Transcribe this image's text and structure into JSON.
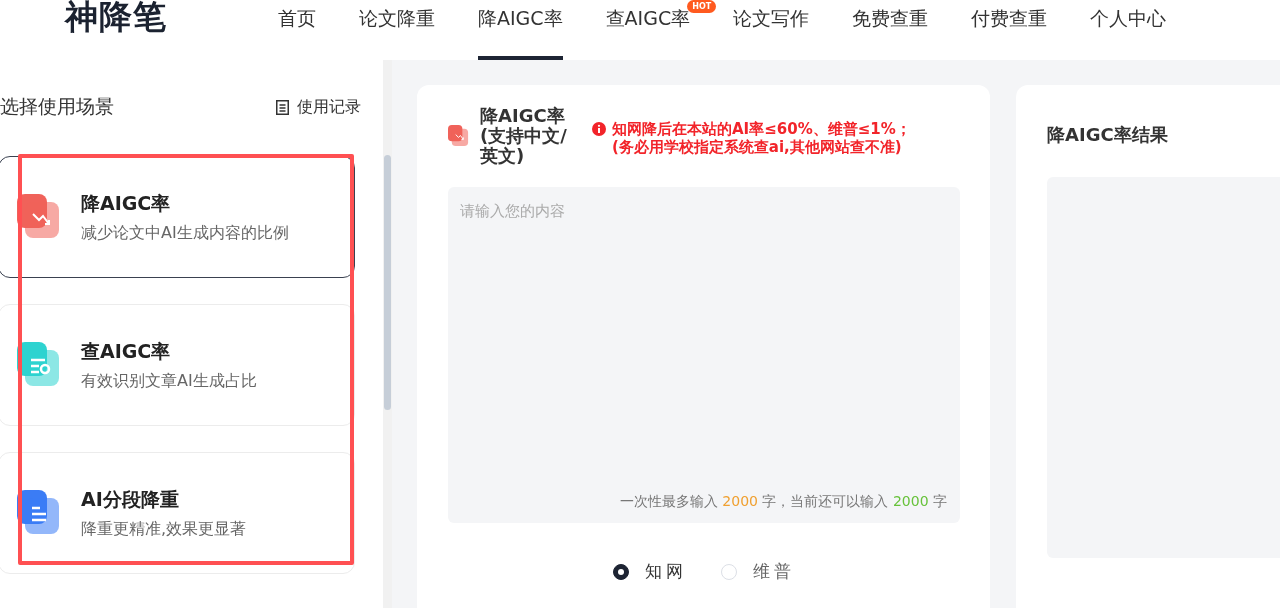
{
  "logo": "神降笔",
  "nav": [
    {
      "label": "首页",
      "selected": false
    },
    {
      "label": "论文降重",
      "selected": false
    },
    {
      "label": "降AIGC率",
      "selected": true
    },
    {
      "label": "查AIGC率",
      "selected": false,
      "badge": "HOT"
    },
    {
      "label": "论文写作",
      "selected": false
    },
    {
      "label": "免费查重",
      "selected": false
    },
    {
      "label": "付费查重",
      "selected": false
    },
    {
      "label": "个人中心",
      "selected": false
    }
  ],
  "sidebar": {
    "title": "选择使用场景",
    "history_link": "使用记录",
    "items": [
      {
        "kind": "reduce",
        "title": "降AIGC率",
        "subtitle": "减少论文中AI生成内容的比例",
        "selected": true,
        "color": "#f0625a"
      },
      {
        "kind": "check",
        "title": "查AIGC率",
        "subtitle": "有效识别文章AI生成占比",
        "selected": false,
        "color": "#2ed3d0"
      },
      {
        "kind": "segment",
        "title": "AI分段降重",
        "subtitle": "降重更精准,效果更显著",
        "selected": false,
        "color": "#3b7cf5"
      }
    ]
  },
  "editor": {
    "title": "降AIGC率(支持中文/英文)",
    "notice": [
      "知网降后在本站的AI率≤60%、维普≤1%；",
      "(务必用学校指定系统查ai,其他网站查不准)"
    ],
    "placeholder": "请输入您的内容",
    "counter": {
      "prefix": "一次性最多输入",
      "max": "2000",
      "middle": "字，当前还可以输入",
      "remaining": "2000",
      "suffix": "字"
    },
    "options": [
      {
        "label": "知网",
        "selected": true
      },
      {
        "label": "维普",
        "selected": false
      }
    ]
  },
  "result": {
    "title": "降AIGC率结果"
  }
}
